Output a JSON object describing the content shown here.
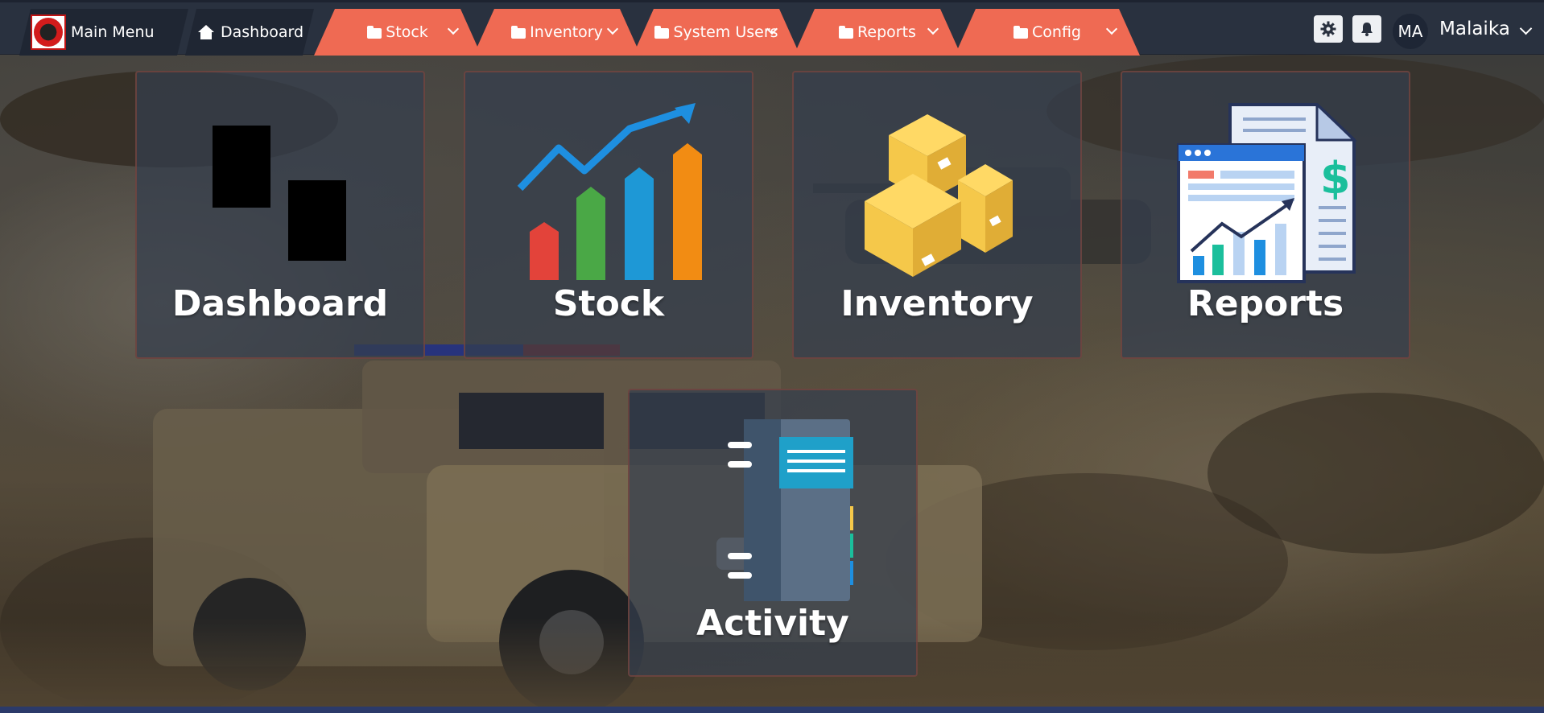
{
  "navbar": {
    "main_menu": "Main Menu",
    "dashboard": "Dashboard",
    "tabs": [
      {
        "label": "Stock",
        "icon": "folder-icon"
      },
      {
        "label": "Inventory",
        "icon": "folder-icon"
      },
      {
        "label": "System Users",
        "icon": "folder-icon"
      },
      {
        "label": "Reports",
        "icon": "folder-icon"
      },
      {
        "label": "Config",
        "icon": "folder-icon"
      }
    ],
    "settings_icon": "gear-icon",
    "notifications_icon": "bell-icon",
    "user_initials": "MA",
    "user_name": "Malaika"
  },
  "tiles": [
    {
      "label": "Dashboard",
      "icon": "dashboard-icon"
    },
    {
      "label": "Stock",
      "icon": "bar-chart-trend-icon"
    },
    {
      "label": "Inventory",
      "icon": "boxes-icon"
    },
    {
      "label": "Reports",
      "icon": "financial-report-icon"
    },
    {
      "label": "Activity",
      "icon": "notebook-icon"
    }
  ],
  "colors": {
    "navbar_bg": "#29313f",
    "tab_accent": "#ef6a53",
    "tile_bg": "#343e4e",
    "tile_border": "#82463c"
  }
}
